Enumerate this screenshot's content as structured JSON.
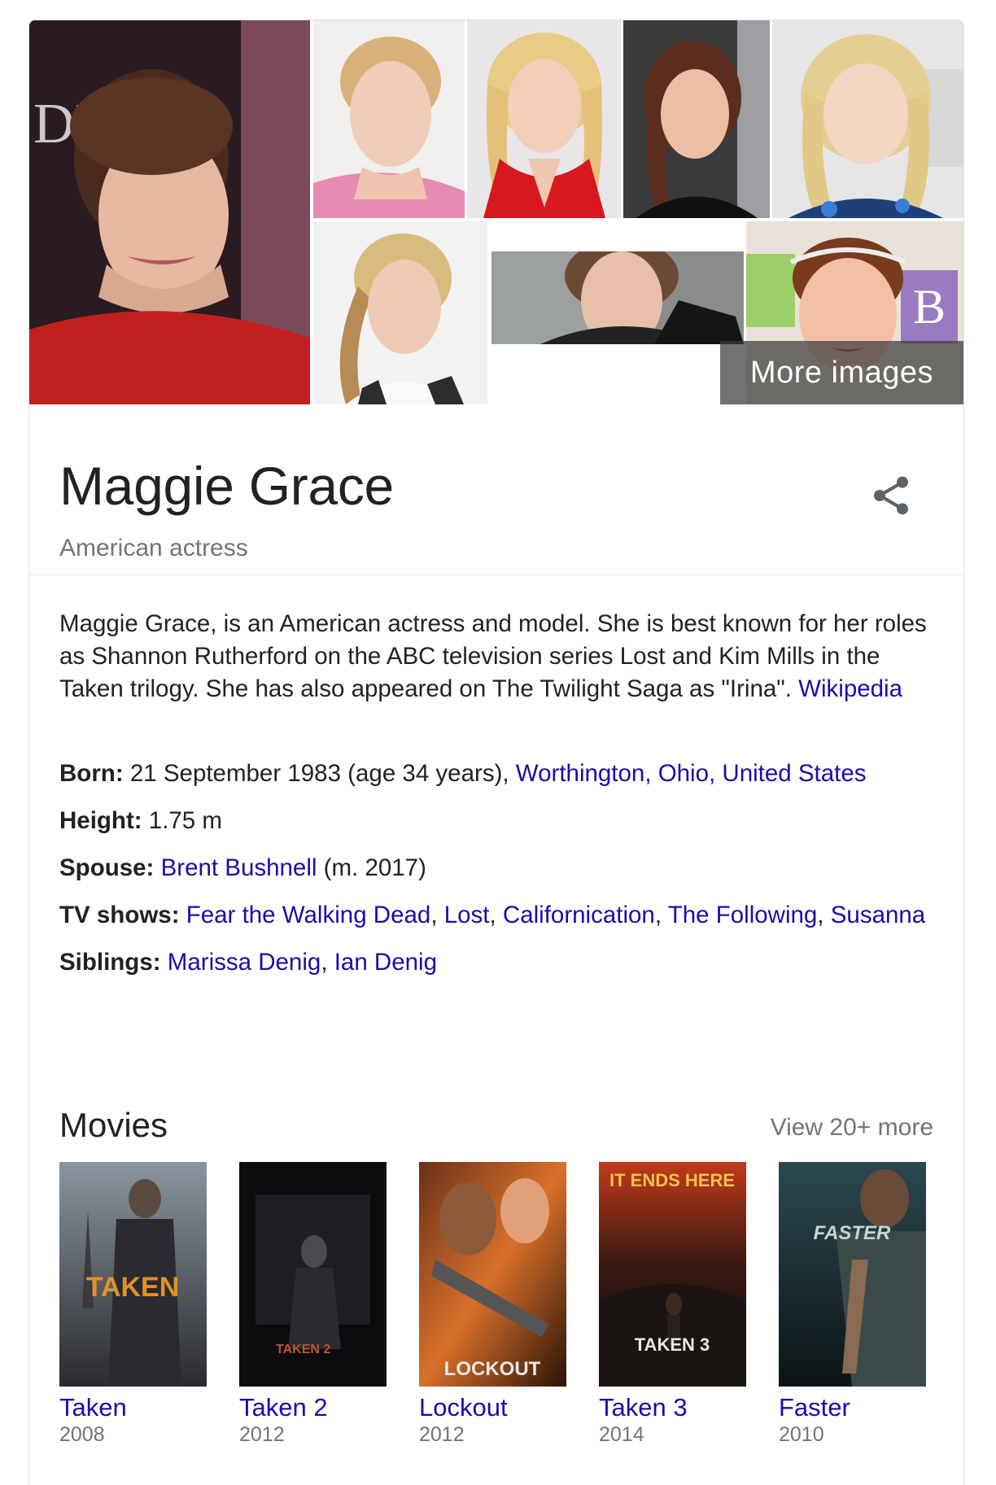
{
  "images": {
    "more_images_label": "More images"
  },
  "entity": {
    "name": "Maggie Grace",
    "subtitle": "American actress"
  },
  "description": {
    "text": "Maggie Grace, is an American actress and model. She is best known for her roles as Shannon Rutherford on the ABC television series Lost and Kim Mills in the Taken trilogy. She has also appeared on The Twilight Saga as \"Irina\". ",
    "source_link": "Wikipedia"
  },
  "facts": {
    "born": {
      "label": "Born:",
      "value": " 21 September 1983 (age 34 years), ",
      "link": "Worthington, Ohio, United States"
    },
    "height": {
      "label": "Height:",
      "value": " 1.75 m"
    },
    "spouse": {
      "label": "Spouse:",
      "link": "Brent Bushnell",
      "suffix": " (m. 2017)"
    },
    "tv_shows": {
      "label": "TV shows:",
      "items": [
        "Fear the Walking Dead",
        "Lost",
        "Californication",
        "The Following",
        "Susanna"
      ]
    },
    "siblings": {
      "label": "Siblings:",
      "items": [
        "Marissa Denig",
        "Ian Denig"
      ]
    }
  },
  "movies": {
    "heading": "Movies",
    "view_more": "View 20+ more",
    "items": [
      {
        "title": "Taken",
        "year": "2008",
        "poster_text": "TAKEN"
      },
      {
        "title": "Taken 2",
        "year": "2012",
        "poster_text": "TAKEN 2"
      },
      {
        "title": "Lockout",
        "year": "2012",
        "poster_text": "LOCKOUT"
      },
      {
        "title": "Taken 3",
        "year": "2014",
        "poster_text": "TAKEN 3"
      },
      {
        "title": "Faster",
        "year": "2010",
        "poster_text": "FASTER"
      }
    ]
  }
}
